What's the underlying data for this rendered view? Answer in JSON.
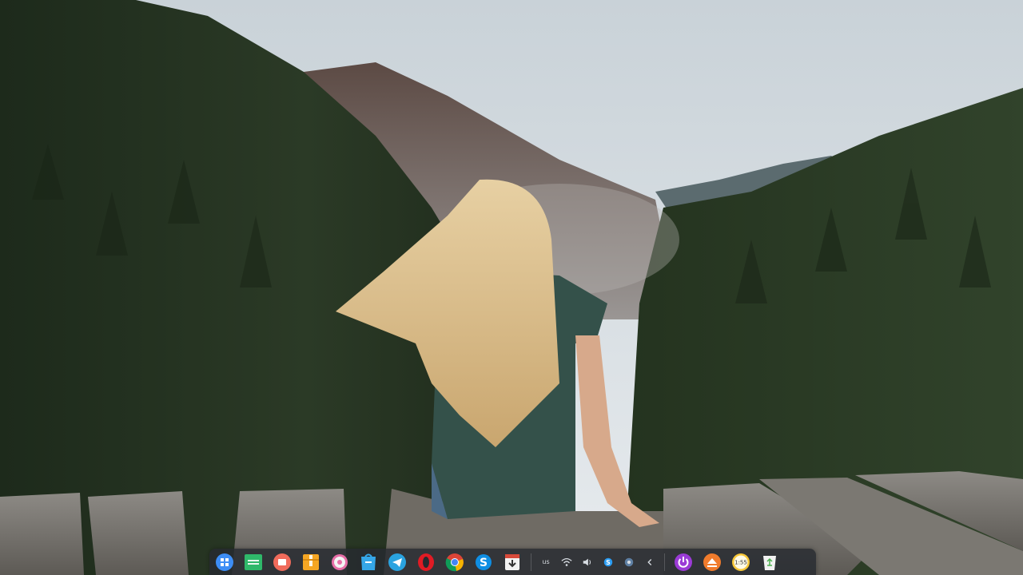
{
  "desktop": {
    "wallpaper": "mountain-forest-woman-on-wooden-deck"
  },
  "dock": {
    "apps": [
      {
        "name": "launcher",
        "icon": "launcher-icon",
        "color": "#3d8df5"
      },
      {
        "name": "file-manager",
        "icon": "folder-icon",
        "color": "#2fb86a"
      },
      {
        "name": "screen-recorder",
        "icon": "record-icon",
        "color": "#f06b5b"
      },
      {
        "name": "archive-manager",
        "icon": "archive-icon",
        "color": "#f5a623"
      },
      {
        "name": "settings",
        "icon": "gear-icon",
        "color": "#e86fa8"
      },
      {
        "name": "app-store",
        "icon": "store-icon",
        "color": "#35a7e8"
      },
      {
        "name": "telegram",
        "icon": "telegram-icon",
        "color": "#2aa3e0"
      },
      {
        "name": "opera",
        "icon": "opera-icon",
        "color": "#e01b24"
      },
      {
        "name": "chrome",
        "icon": "chrome-icon",
        "color": "#4285f4"
      },
      {
        "name": "skype",
        "icon": "skype-icon",
        "color": "#0f8ee3"
      },
      {
        "name": "package-installer",
        "icon": "installer-icon",
        "color": "#d84a3a"
      }
    ],
    "tray": {
      "keyboard_layout": "us",
      "items": [
        "wifi-icon",
        "volume-icon",
        "skype-tray-icon",
        "chat-tray-icon",
        "expand-tray-icon"
      ]
    },
    "system": [
      {
        "name": "power",
        "icon": "power-icon",
        "color": "#9b3bd6"
      },
      {
        "name": "eject",
        "icon": "eject-icon",
        "color": "#f07b2c"
      },
      {
        "name": "clock",
        "icon": "clock-icon",
        "color": "#f7c73a",
        "label": "1:55"
      },
      {
        "name": "trash",
        "icon": "trash-icon",
        "color": "#f2f2f2"
      }
    ]
  }
}
